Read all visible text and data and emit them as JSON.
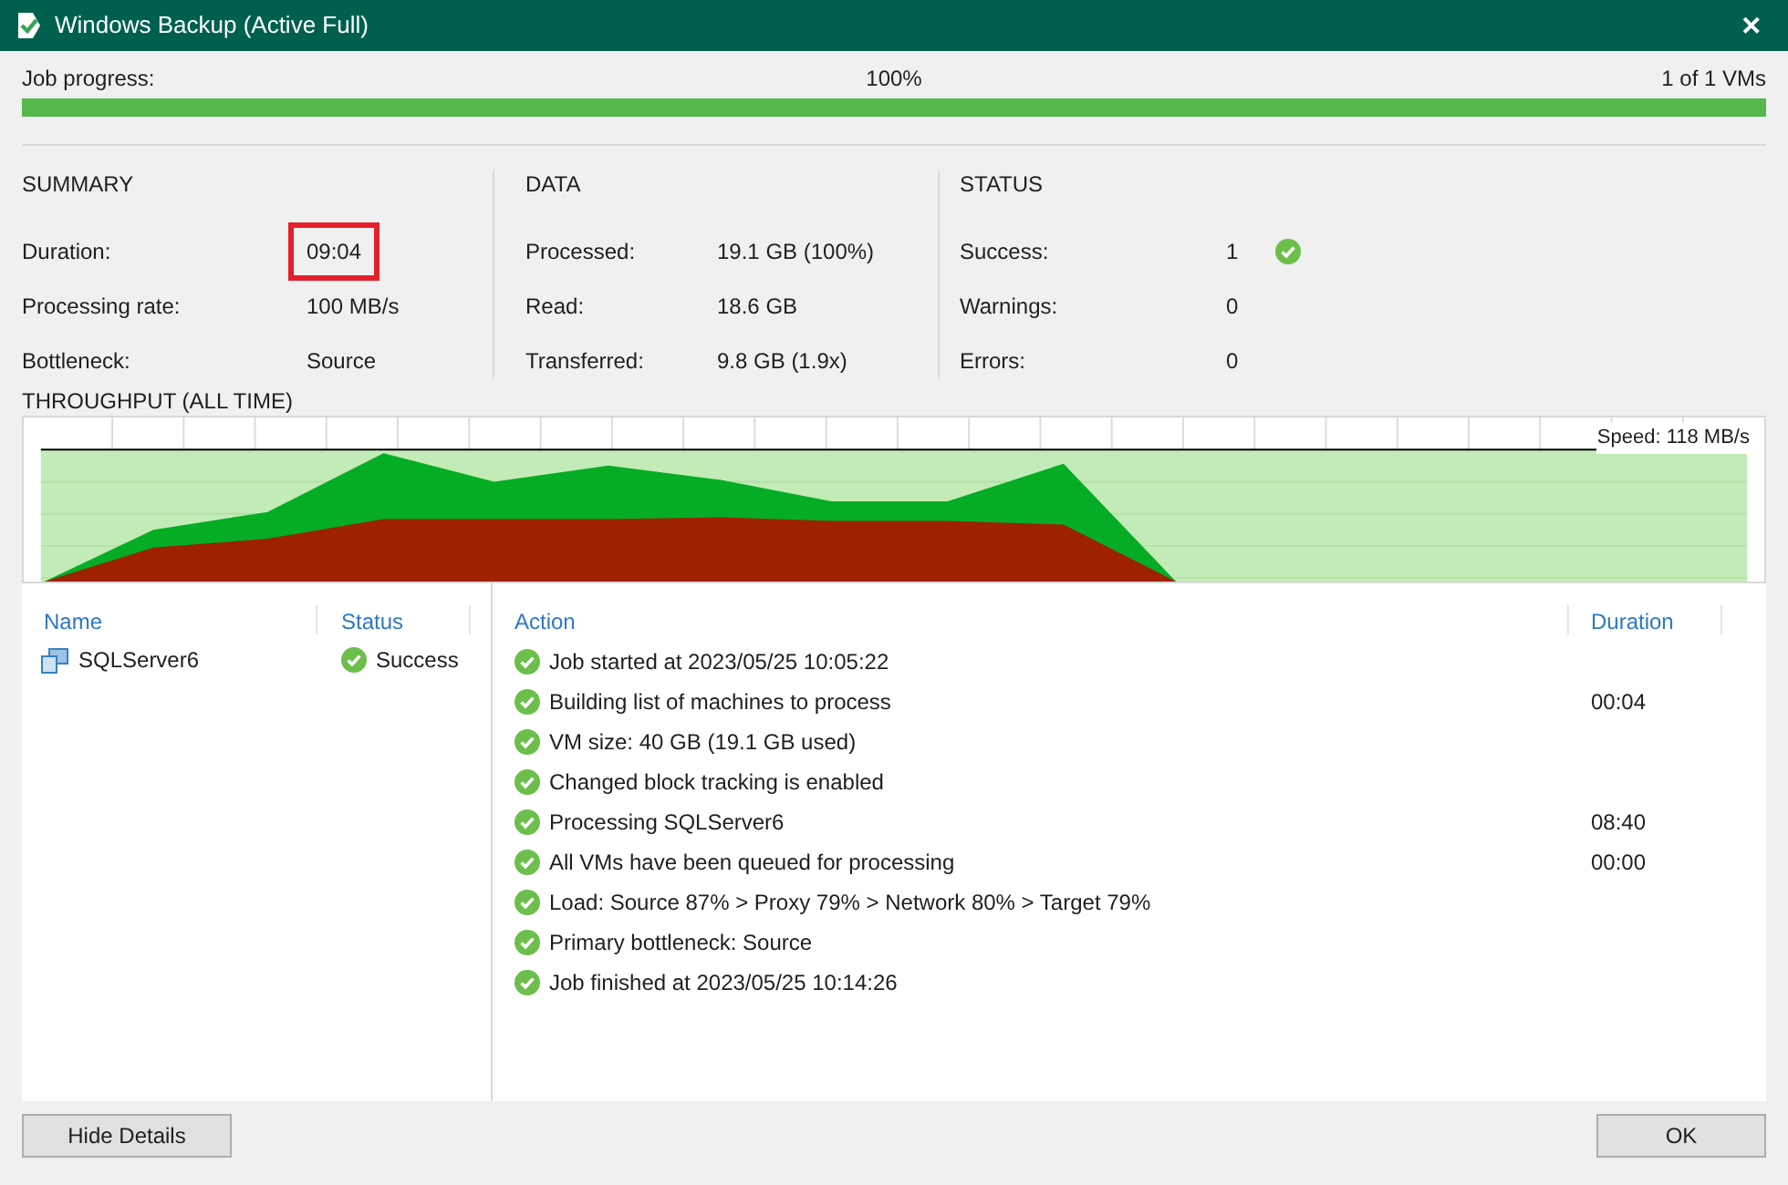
{
  "window": {
    "title": "Windows Backup (Active Full)",
    "close": "✕"
  },
  "progress": {
    "label": "Job progress:",
    "percent": "100%",
    "count": "1 of 1 VMs",
    "level": 1
  },
  "sections": [
    {
      "title": "SUMMARY",
      "rows": [
        {
          "label": "Duration:",
          "value": "09:04",
          "highlighted": true,
          "ok": false
        },
        {
          "label": "Processing rate:",
          "value": "100 MB/s",
          "highlighted": false,
          "ok": false
        },
        {
          "label": "Bottleneck:",
          "value": "Source",
          "highlighted": false,
          "ok": false
        }
      ]
    },
    {
      "title": "DATA",
      "rows": [
        {
          "label": "Processed:",
          "value": "19.1 GB (100%)",
          "highlighted": false,
          "ok": false
        },
        {
          "label": "Read:",
          "value": "18.6 GB",
          "highlighted": false,
          "ok": false
        },
        {
          "label": "Transferred:",
          "value": "9.8 GB (1.9x)",
          "highlighted": false,
          "ok": false
        }
      ]
    },
    {
      "title": "STATUS",
      "rows": [
        {
          "label": "Success:",
          "value": "1",
          "highlighted": false,
          "ok": true
        },
        {
          "label": "Warnings:",
          "value": "0",
          "highlighted": false,
          "ok": false
        },
        {
          "label": "Errors:",
          "value": "0",
          "highlighted": false,
          "ok": false
        }
      ]
    }
  ],
  "throughput": {
    "title": "THROUGHPUT (ALL TIME)",
    "speed": "Speed: 118 MB/s"
  },
  "vms": {
    "columns": [
      "Name",
      "Status"
    ],
    "rows": [
      {
        "name": "SQLServer6",
        "status": "Success",
        "selected": false
      }
    ]
  },
  "log": {
    "columns": [
      "Action",
      "Duration"
    ],
    "rows": [
      {
        "action": "Job started at 2023/05/25 10:05:22",
        "duration": ""
      },
      {
        "action": "Building list of machines to process",
        "duration": "00:04"
      },
      {
        "action": "VM size: 40 GB (19.1 GB used)",
        "duration": ""
      },
      {
        "action": "Changed block tracking is enabled",
        "duration": ""
      },
      {
        "action": "Processing SQLServer6",
        "duration": "08:40"
      },
      {
        "action": "All VMs have been queued for processing",
        "duration": "00:00"
      },
      {
        "action": "Load: Source 87% > Proxy 79% > Network 80% > Target 79%",
        "duration": ""
      },
      {
        "action": "Primary bottleneck: Source",
        "duration": ""
      },
      {
        "action": "Job finished at 2023/05/25 10:14:26",
        "duration": ""
      }
    ]
  },
  "buttons": {
    "hide": "Hide Details",
    "ok": "OK"
  }
}
